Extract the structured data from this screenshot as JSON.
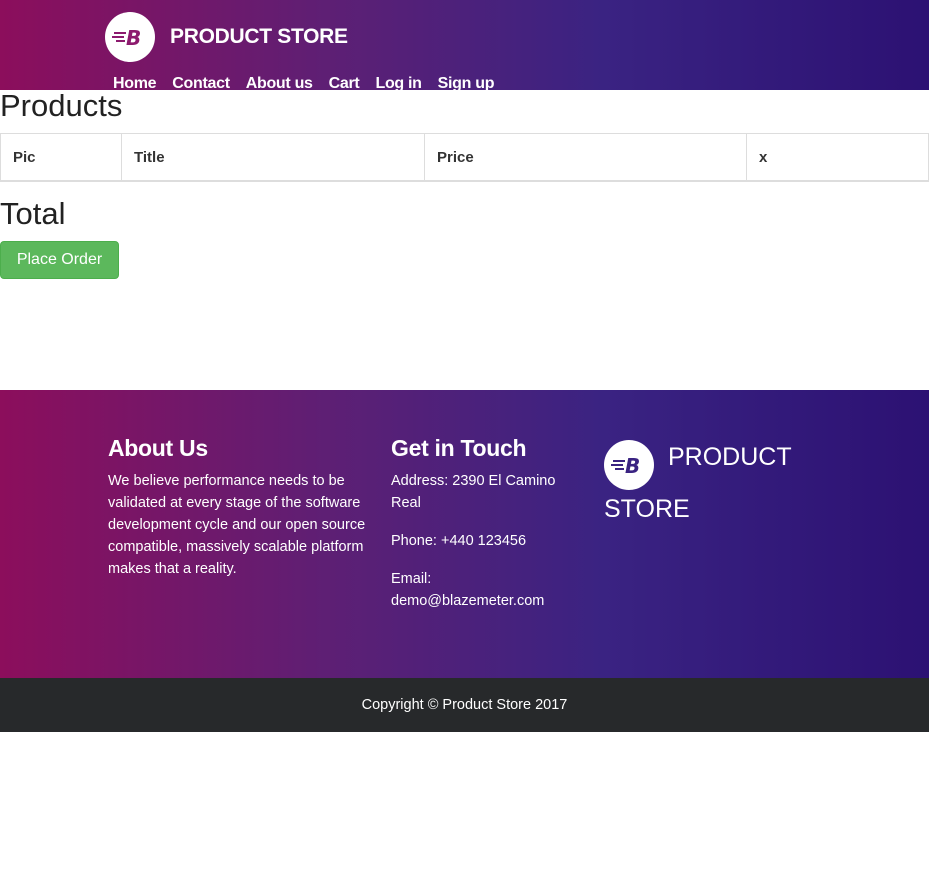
{
  "header": {
    "brand": "PRODUCT STORE",
    "logo_icon": "blazemeter-logo-icon",
    "nav": [
      "Home",
      "Contact",
      "About us",
      "Cart",
      "Log in",
      "Sign up"
    ],
    "colors": {
      "gradient_start": "#8c0e5c",
      "gradient_end": "#2c1173"
    }
  },
  "main": {
    "products_title": "Products",
    "table": {
      "columns": [
        "Pic",
        "Title",
        "Price",
        "x"
      ],
      "rows": []
    },
    "total_title": "Total",
    "place_order_label": "Place Order",
    "button_color": "#5cb85c"
  },
  "footer": {
    "about": {
      "heading": "About Us",
      "text": "We believe performance needs to be validated at every stage of the software development cycle and our open source compatible, massively scalable platform makes that a reality."
    },
    "touch": {
      "heading": "Get in Touch",
      "address": "Address: 2390 El Camino Real",
      "phone": "Phone: +440 123456",
      "email": "Email: demo@blazemeter.com"
    },
    "brand": "PRODUCT STORE",
    "copyright": "Copyright © Product Store 2017",
    "copyright_bg": "#27292b"
  }
}
